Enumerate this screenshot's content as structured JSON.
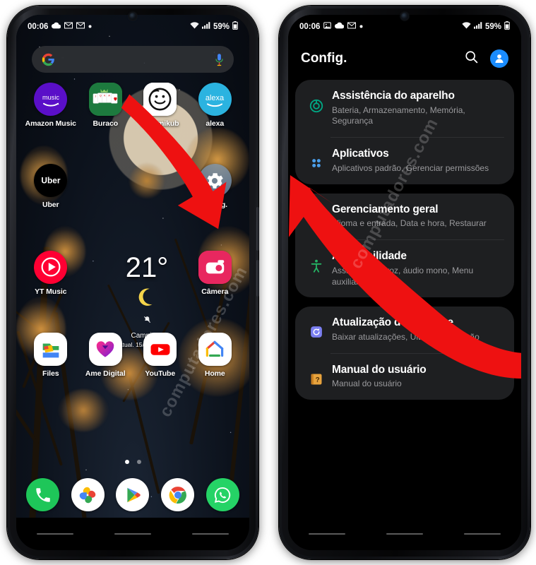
{
  "left_phone": {
    "status_bar": {
      "time": "00:06",
      "icons_left": [
        "cloud-icon",
        "mail-icon",
        "mail-icon",
        "dot-icon"
      ],
      "battery_percent": "59%",
      "icons_right": [
        "wifi-icon",
        "signal-icon",
        "battery-icon"
      ]
    },
    "search": {
      "placeholder": "",
      "logo": "google-g-icon",
      "mic": "microphone-icon"
    },
    "apps_rows": [
      [
        {
          "label": "Amazon\nMusic",
          "icon": "amazon-music-icon",
          "color": "#5a0fc8"
        },
        {
          "label": "Buraco",
          "icon": "buraco-cards-icon",
          "color": "#1d7a3e"
        },
        {
          "label": "Rummikub",
          "icon": "rummikub-face-icon",
          "color": "#ffffff"
        },
        {
          "label": "alexa",
          "icon": "alexa-icon",
          "color": "#2bb3e0"
        }
      ],
      [
        {
          "label": "Uber",
          "icon": "uber-icon",
          "color": "#000000"
        },
        {
          "label": "",
          "icon": "",
          "color": ""
        },
        {
          "label": "",
          "icon": "",
          "color": ""
        },
        {
          "label": "Config.",
          "icon": "settings-gear-icon",
          "color": "#6d8fb0"
        }
      ],
      [
        {
          "label": "YT Music",
          "icon": "yt-music-icon",
          "color": "#ff0033"
        },
        {
          "label": "",
          "icon": "",
          "color": ""
        },
        {
          "label": "",
          "icon": "",
          "color": ""
        },
        {
          "label": "Câmera",
          "icon": "camera-icon",
          "color": "#e8275f"
        }
      ],
      [
        {
          "label": "Files",
          "icon": "files-icon",
          "color": "#ffffff"
        },
        {
          "label": "Ame Digital",
          "icon": "ame-digital-icon",
          "color": "#ffffff"
        },
        {
          "label": "YouTube",
          "icon": "youtube-icon",
          "color": "#ffffff"
        },
        {
          "label": "Home",
          "icon": "google-home-icon",
          "color": "#ffffff"
        }
      ]
    ],
    "weather": {
      "temperature": "21°",
      "condition_icon": "moon-icon",
      "mute_icon": "bell-off-icon",
      "city": "Campinas",
      "updated": "Atual. 15/08 22:55",
      "refresh_icon": "refresh-icon"
    },
    "page_dots": {
      "count": 2,
      "active_index": 0
    },
    "dock": [
      {
        "label": "phone",
        "icon": "phone-icon",
        "color": "#1ec659"
      },
      {
        "label": "photos",
        "icon": "google-photos-icon",
        "color": "#ffffff"
      },
      {
        "label": "play-store",
        "icon": "play-store-icon",
        "color": "#ffffff"
      },
      {
        "label": "chrome",
        "icon": "chrome-icon",
        "color": "#ffffff"
      },
      {
        "label": "whatsapp",
        "icon": "whatsapp-icon",
        "color": "#25d366"
      }
    ],
    "nav_bar": [
      "recents-line",
      "home-line",
      "back-line"
    ]
  },
  "right_phone": {
    "status_bar": {
      "time": "00:06",
      "icons_left": [
        "image-icon",
        "cloud-icon",
        "mail-icon",
        "dot-icon"
      ],
      "battery_percent": "59%",
      "icons_right": [
        "wifi-icon",
        "signal-icon",
        "battery-icon"
      ]
    },
    "header": {
      "title": "Config.",
      "search_icon": "search-icon",
      "account_icon": "account-avatar-icon"
    },
    "groups": [
      {
        "items": [
          {
            "title": "Assistência do aparelho",
            "subtitle": "Bateria, Armazenamento, Memória, Segurança",
            "icon": "device-care-icon",
            "icon_color": "#00a884"
          },
          {
            "title": "Aplicativos",
            "subtitle": "Aplicativos padrão, Gerenciar permissões",
            "icon": "apps-grid-icon",
            "icon_color": "#4a9eea"
          }
        ]
      },
      {
        "items": [
          {
            "title": "Gerenciamento geral",
            "subtitle": "Idioma e entrada, Data e hora, Restaurar",
            "icon": "sliders-icon",
            "icon_color": "#6cb2e8"
          },
          {
            "title": "Acessibilidade",
            "subtitle": "Assistente de voz, áudio mono, Menu auxiliar",
            "icon": "accessibility-icon",
            "icon_color": "#25b364"
          }
        ]
      },
      {
        "items": [
          {
            "title": "Atualização de software",
            "subtitle": "Baixar atualizações, Última atualização",
            "icon": "software-update-icon",
            "icon_color": "#7b7ff0"
          },
          {
            "title": "Manual do usuário",
            "subtitle": "Manual do usuário",
            "icon": "user-manual-icon",
            "icon_color": "#e8a33d"
          }
        ]
      }
    ],
    "nav_bar": [
      "recents-line",
      "home-line",
      "back-line"
    ]
  },
  "annotations": {
    "arrow_color": "#ee1111",
    "left_arrow_target": "Config.",
    "right_arrow_target": "Gerenciamento geral"
  },
  "watermark": {
    "text": "computadores.com"
  }
}
